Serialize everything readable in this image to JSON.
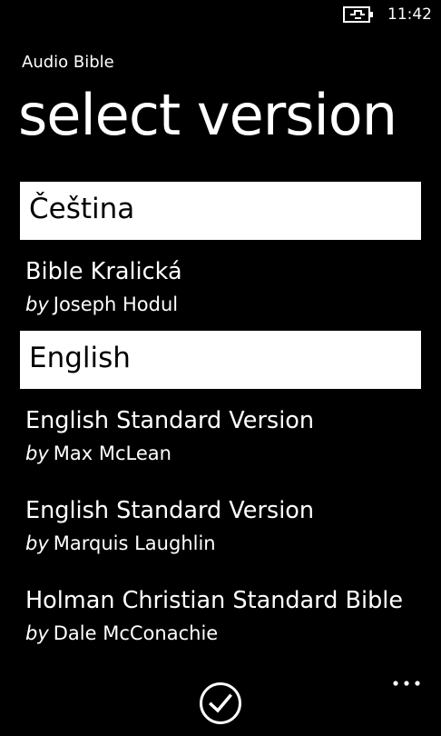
{
  "status_bar": {
    "time": "11:42",
    "battery_icon": "battery-charging-icon"
  },
  "header": {
    "app_title": "Audio Bible",
    "page_title": "select version"
  },
  "groups": [
    {
      "header": "Čeština",
      "items": [
        {
          "title": "Bible Kralická",
          "by": "by",
          "author": "Joseph Hodul"
        }
      ]
    },
    {
      "header": "English",
      "items": [
        {
          "title": "English Standard Version",
          "by": "by",
          "author": "Max McLean"
        },
        {
          "title": "English Standard Version",
          "by": "by",
          "author": "Marquis Laughlin"
        },
        {
          "title": "Holman Christian Standard Bible",
          "by": "by",
          "author": "Dale McConachie"
        }
      ]
    }
  ],
  "app_bar": {
    "confirm_icon": "check-circle-icon",
    "more_icon": "ellipsis-icon"
  }
}
